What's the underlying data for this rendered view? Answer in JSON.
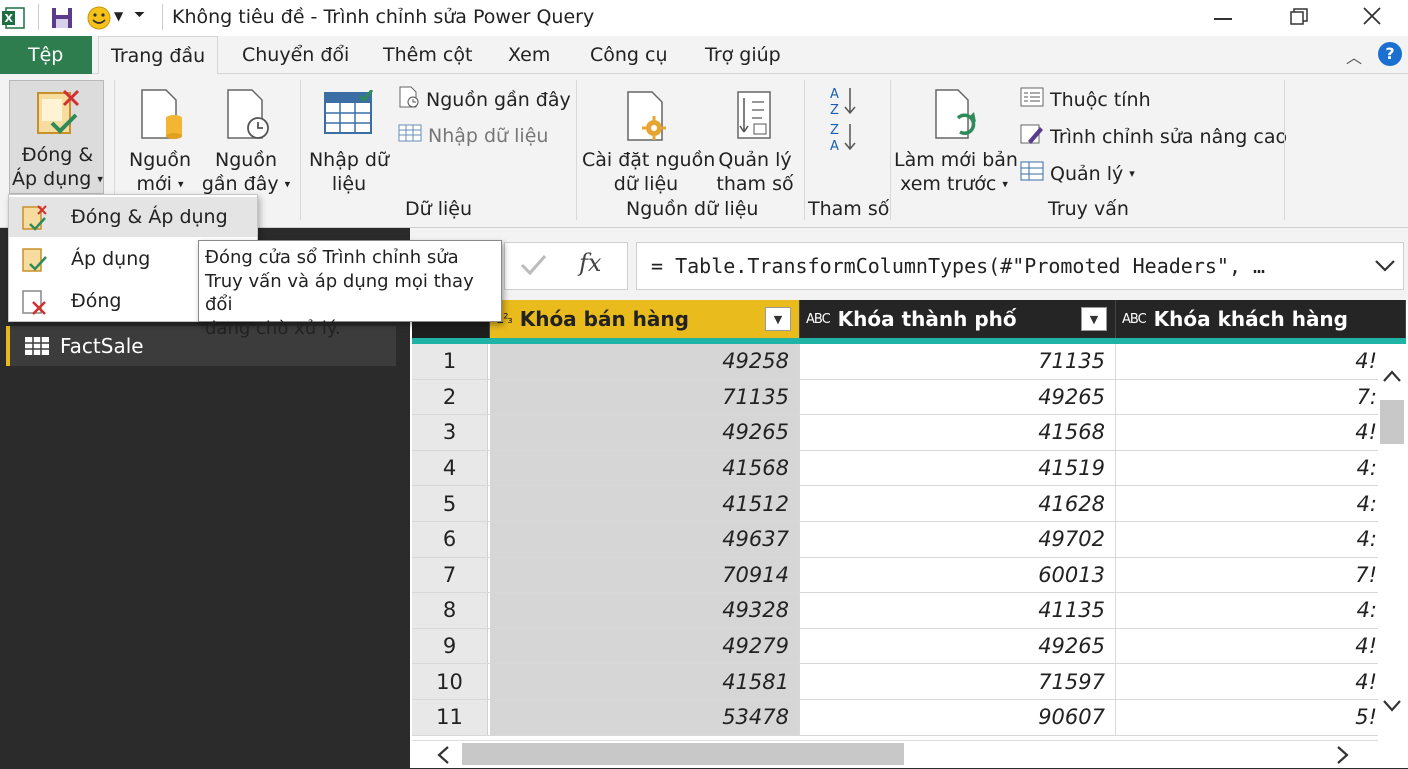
{
  "window": {
    "title": "Không tiêu đề - Trình chỉnh sửa Power Query"
  },
  "tabs": {
    "file": "Tệp",
    "home": "Trang đầu",
    "transform": "Chuyển đổi",
    "add_column": "Thêm cột",
    "view": "Xem",
    "tools": "Công cụ",
    "help": "Trợ giúp"
  },
  "ribbon": {
    "close_apply_l1": "Đóng &",
    "close_apply_l2": "Áp dụng",
    "new_source_l1": "Nguồn",
    "new_source_l2": "mới",
    "recent_sources_l1": "Nguồn",
    "recent_sources_l2": "gần đây",
    "enter_data_l1": "Nhập dữ",
    "enter_data_l2": "liệu",
    "recent_sources_small": "Nguồn gần đây",
    "enter_data_small": "Nhập dữ liệu",
    "group_data": "Dữ liệu",
    "data_source_settings_l1": "Cài đặt nguồn",
    "data_source_settings_l2": "dữ liệu",
    "manage_params_l1": "Quản lý",
    "manage_params_l2": "tham số",
    "group_data_sources": "Nguồn dữ liệu",
    "group_params": "Tham số",
    "refresh_l1": "Làm mới bản",
    "refresh_l2": "xem trước",
    "properties": "Thuộc tính",
    "advanced_editor": "Trình chỉnh sửa nâng cao",
    "manage": "Quản lý",
    "group_query": "Truy vấn"
  },
  "dropdown": {
    "items": [
      "Đóng & Áp dụng",
      "Áp dụng",
      "Đóng"
    ]
  },
  "tooltip": {
    "line1": "Đóng cửa sổ Trình chỉnh sửa",
    "line2": "Truy vấn và áp dụng mọi thay đổi",
    "line3": "đang chờ xử lý."
  },
  "queries": {
    "items": [
      "FactSale"
    ]
  },
  "formula": {
    "fx": "fx",
    "text": "= Table.TransformColumnTypes(#\"Promoted Headers\", …"
  },
  "grid": {
    "type_badge": "A B C",
    "columns": [
      "Khóa bán hàng",
      "Khóa thành phố",
      "Khóa khách hàng"
    ],
    "rows": [
      {
        "n": "1",
        "c": [
          "49258",
          "71135",
          "4!"
        ]
      },
      {
        "n": "2",
        "c": [
          "71135",
          "49265",
          "7:"
        ]
      },
      {
        "n": "3",
        "c": [
          "49265",
          "41568",
          "4!"
        ]
      },
      {
        "n": "4",
        "c": [
          "41568",
          "41519",
          "4:"
        ]
      },
      {
        "n": "5",
        "c": [
          "41512",
          "41628",
          "4:"
        ]
      },
      {
        "n": "6",
        "c": [
          "49637",
          "49702",
          "4:"
        ]
      },
      {
        "n": "7",
        "c": [
          "70914",
          "60013",
          "7!"
        ]
      },
      {
        "n": "8",
        "c": [
          "49328",
          "41135",
          "4:"
        ]
      },
      {
        "n": "9",
        "c": [
          "49279",
          "49265",
          "4!"
        ]
      },
      {
        "n": "10",
        "c": [
          "41581",
          "71597",
          "4!"
        ]
      },
      {
        "n": "11",
        "c": [
          "53478",
          "90607",
          "5!"
        ]
      }
    ]
  },
  "colors": {
    "file_tab": "#2e7d4f",
    "selected_column": "#e9bb1c",
    "header_bg": "#252525",
    "teal_bar": "#1fb3a6",
    "query_accent": "#e8b820"
  }
}
